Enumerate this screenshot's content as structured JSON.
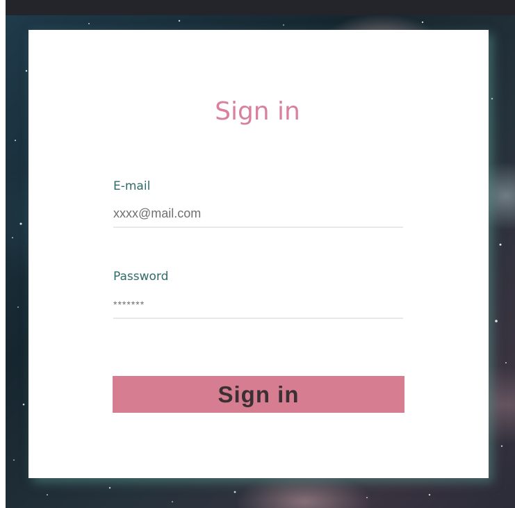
{
  "form": {
    "title": "Sign in",
    "email": {
      "label": "E-mail",
      "value": "xxxx@mail.com"
    },
    "password": {
      "label": "Password",
      "value": "*******"
    },
    "submit_label": "Sign in"
  },
  "colors": {
    "accent": "#d8809c",
    "button": "#d77d91",
    "label": "#2e6b6a",
    "top_bar": "#23252b"
  }
}
